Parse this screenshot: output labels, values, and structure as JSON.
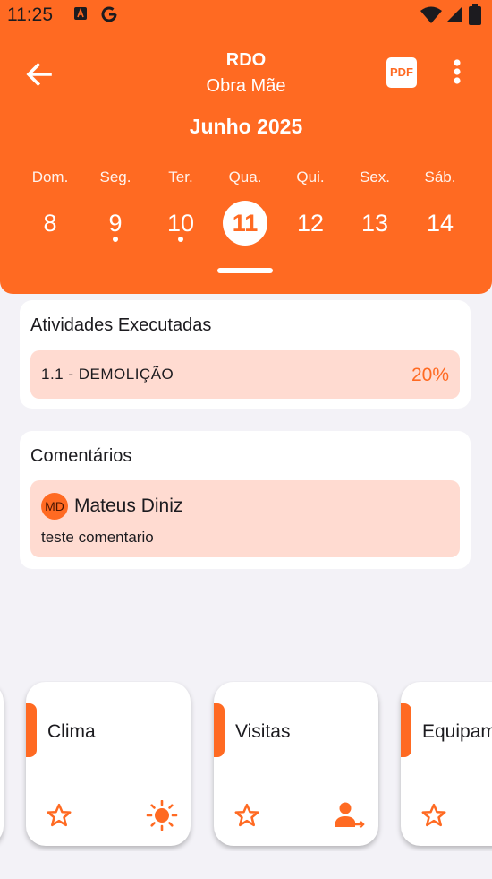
{
  "status_bar": {
    "time": "11:25"
  },
  "header": {
    "title": "RDO",
    "subtitle": "Obra Mãe",
    "pdf_label": "PDF",
    "month": "Junho 2025",
    "days": [
      {
        "name": "Dom.",
        "num": "8",
        "selected": false,
        "dot": false
      },
      {
        "name": "Seg.",
        "num": "9",
        "selected": false,
        "dot": true
      },
      {
        "name": "Ter.",
        "num": "10",
        "selected": false,
        "dot": true
      },
      {
        "name": "Qua.",
        "num": "11",
        "selected": true,
        "dot": false
      },
      {
        "name": "Qui.",
        "num": "12",
        "selected": false,
        "dot": false
      },
      {
        "name": "Sex.",
        "num": "13",
        "selected": false,
        "dot": false
      },
      {
        "name": "Sáb.",
        "num": "14",
        "selected": false,
        "dot": false
      }
    ]
  },
  "activities": {
    "title": "Atividades Executadas",
    "items": [
      {
        "name": "1.1 - DEMOLIÇÃO",
        "percent": "20%"
      }
    ]
  },
  "comments": {
    "title": "Comentários",
    "items": [
      {
        "initials": "MD",
        "author": "Mateus Diniz",
        "text": "teste comentario"
      }
    ]
  },
  "tiles": [
    {
      "label": "Clima",
      "icon": "sun-icon"
    },
    {
      "label": "Visitas",
      "icon": "person-arrow-icon"
    },
    {
      "label": "Equipamentos",
      "icon": "equipment-icon"
    }
  ],
  "colors": {
    "accent": "#ff6a22",
    "chip": "#ffdbd1",
    "background": "#f3f2f7"
  }
}
